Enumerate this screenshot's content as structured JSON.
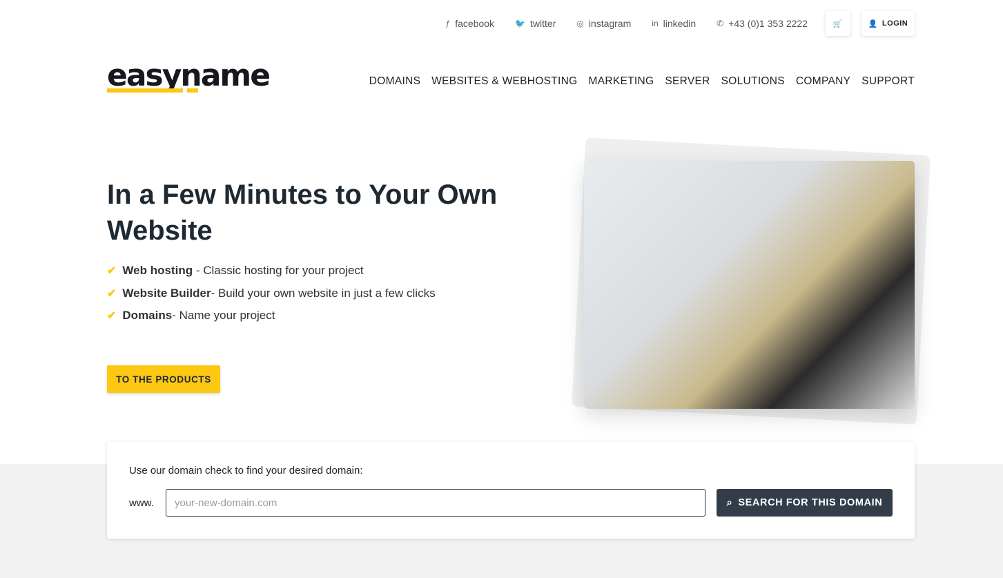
{
  "topbar": {
    "facebook": "facebook",
    "twitter": "twitter",
    "instagram": "instagram",
    "linkedin": "linkedin",
    "phone": "+43 (0)1 353 2222",
    "login": "LOGIN"
  },
  "logo": "easyname",
  "nav": [
    "DOMAINS",
    "WEBSITES & WEBHOSTING",
    "MARKETING",
    "SERVER",
    "SOLUTIONS",
    "COMPANY",
    "SUPPORT"
  ],
  "hero": {
    "title": "In a Few Minutes to Your Own Website",
    "features": [
      {
        "bold": "Web hosting",
        "text": " - Classic hosting for your project"
      },
      {
        "bold": "Website Builder",
        "text": " - Build your own website in just a few clicks"
      },
      {
        "bold": "Domains",
        "text": " - Name your project"
      }
    ],
    "cta": "TO THE PRODUCTS"
  },
  "domain_check": {
    "label": "Use our domain check to find your desired domain:",
    "prefix": "www.",
    "placeholder": "your-new-domain.com",
    "button": "SEARCH FOR THIS DOMAIN"
  },
  "colors": {
    "accent": "#fcc812",
    "dark": "#333d49"
  }
}
